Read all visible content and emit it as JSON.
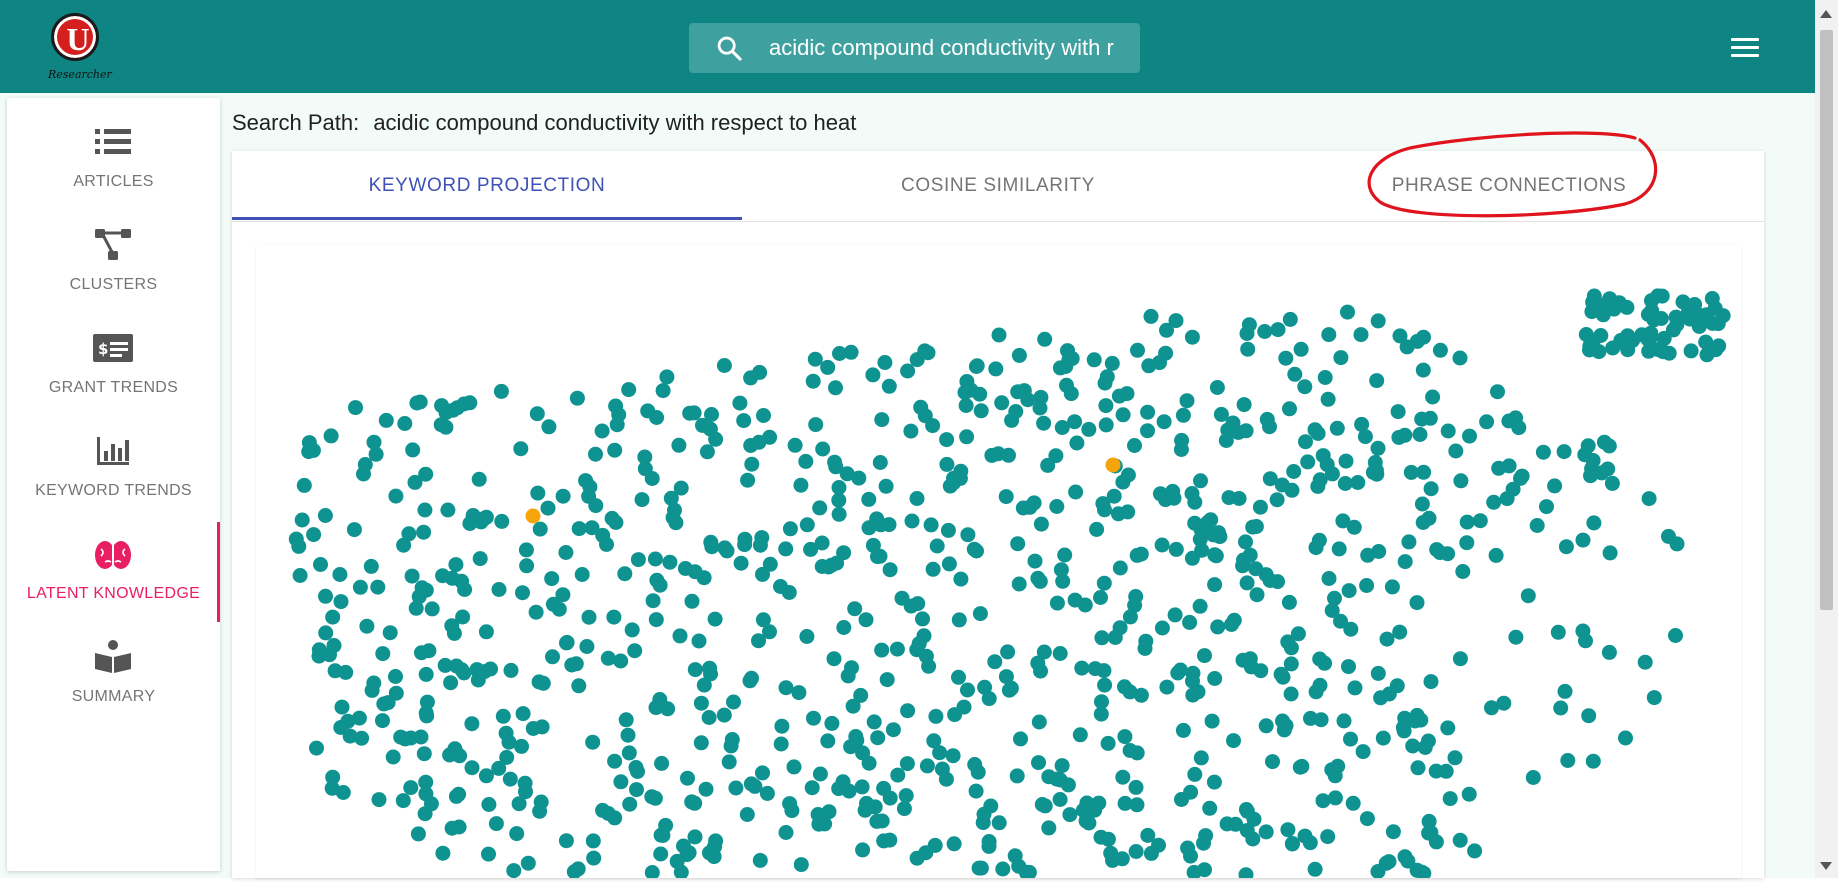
{
  "app": {
    "logo_letter": "U",
    "logo_caption": "Researcher",
    "search_value": "acidic compound conductivity with r",
    "search_icon": "search-icon",
    "menu_icon": "hamburger-menu-icon"
  },
  "sidebar": {
    "items": [
      {
        "label": "ARTICLES",
        "icon": "list-icon",
        "active": false
      },
      {
        "label": "CLUSTERS",
        "icon": "cluster-tree-icon",
        "active": false
      },
      {
        "label": "GRANT TRENDS",
        "icon": "grant-money-icon",
        "active": false
      },
      {
        "label": "KEYWORD TRENDS",
        "icon": "bar-chart-icon",
        "active": false
      },
      {
        "label": "LATENT KNOWLEDGE",
        "icon": "brain-icon",
        "active": true
      },
      {
        "label": "SUMMARY",
        "icon": "reader-book-icon",
        "active": false
      }
    ]
  },
  "search_path": {
    "label": "Search Path:",
    "value": "acidic compound conductivity with respect to heat"
  },
  "tabs": [
    {
      "label": "KEYWORD PROJECTION",
      "active": true
    },
    {
      "label": "COSINE SIMILARITY",
      "active": false
    },
    {
      "label": "PHRASE CONNECTIONS",
      "active": false,
      "highlighted": true
    }
  ],
  "colors": {
    "header": "#0e8583",
    "accent_pink": "#e91e63",
    "tab_active": "#3f51b5",
    "point": "#0e9391",
    "highlight_point": "#f5a50a",
    "annotation": "#e0141c"
  },
  "chart_data": {
    "type": "scatter",
    "description_points": "dense cloud of keyword embedding projections (~1000 teal points) with two highlighted orange points",
    "highlighted_points_count": 2
  }
}
